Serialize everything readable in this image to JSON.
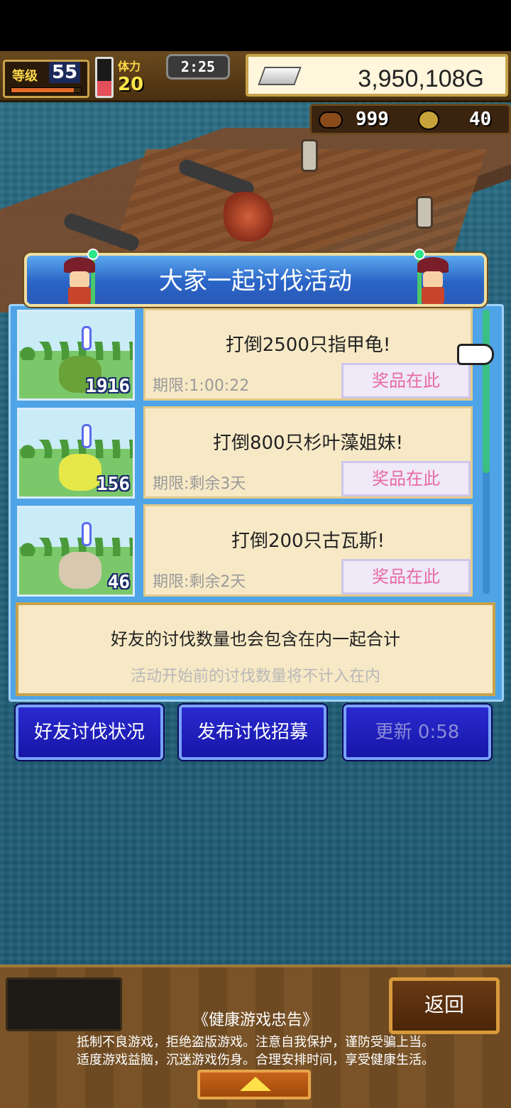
{
  "hud": {
    "level_label": "等级",
    "level": "55",
    "level_progress": 0.9,
    "stamina_gauge": 0.4,
    "stamina_label": "体力",
    "stamina": "20",
    "timer": "2:25",
    "gold": "3,950,108G",
    "resource_1": "999",
    "resource_2": "40"
  },
  "panel": {
    "title": "大家一起讨伐活动",
    "events": [
      {
        "title": "打倒2500只指甲龟!",
        "deadline": "期限:1:00:22",
        "reward_label": "奖品在此",
        "count": "1916",
        "monster_color": "#6aa23a"
      },
      {
        "title": "打倒800只杉叶藻姐妹!",
        "deadline": "期限:剩余3天",
        "reward_label": "奖品在此",
        "count": "156",
        "monster_color": "#e6e84a"
      },
      {
        "title": "打倒200只古瓦斯!",
        "deadline": "期限:剩余2天",
        "reward_label": "奖品在此",
        "count": "46",
        "monster_color": "#d8c8b0"
      }
    ],
    "notice_main": "好友的讨伐数量也会包含在内一起合计",
    "notice_sub": "活动开始前的讨伐数量将不计入在内"
  },
  "buttons": {
    "friends_status": "好友讨伐状况",
    "post_recruit": "发布讨伐招募",
    "refresh": "更新 0:58"
  },
  "footer": {
    "back": "返回",
    "health_title": "《健康游戏忠告》",
    "health_line1": "抵制不良游戏，拒绝盗版游戏。注意自我保护，谨防受骗上当。",
    "health_line2": "适度游戏益脑，沉迷游戏伤身。合理安排时间，享受健康生活。"
  },
  "colors": {
    "panel_blue": "#4ea4e6",
    "card_bg": "#f7e9c6",
    "reward_text": "#e86aa2",
    "button_blue": "#1e1ebc"
  }
}
